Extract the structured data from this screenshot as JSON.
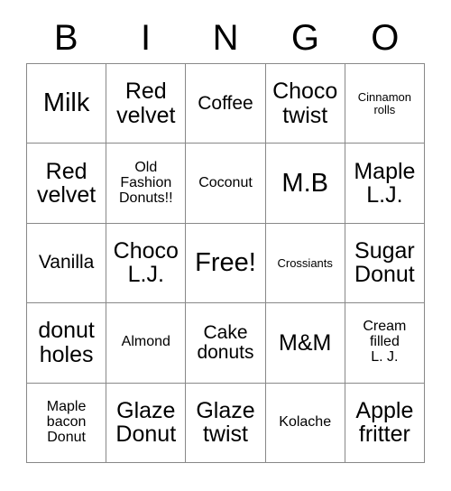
{
  "card": {
    "title": "BINGO",
    "header_letters": [
      "B",
      "I",
      "N",
      "G",
      "O"
    ],
    "grid_size": "5x5",
    "free_space_label": "Free!",
    "colors": {
      "background": "#ffffff",
      "text": "#000000",
      "grid_line": "#888888"
    },
    "rows": [
      [
        {
          "label": "Milk",
          "size": "xl"
        },
        {
          "label": "Red\nvelvet",
          "size": "lg"
        },
        {
          "label": "Coffee",
          "size": "md"
        },
        {
          "label": "Choco\ntwist",
          "size": "lg"
        },
        {
          "label": "Cinnamon\nrolls",
          "size": "xs"
        }
      ],
      [
        {
          "label": "Red\nvelvet",
          "size": "lg"
        },
        {
          "label": "Old\nFashion\nDonuts!!",
          "size": "sm"
        },
        {
          "label": "Coconut",
          "size": "sm"
        },
        {
          "label": "M.B",
          "size": "xl"
        },
        {
          "label": "Maple\nL.J.",
          "size": "lg"
        }
      ],
      [
        {
          "label": "Vanilla",
          "size": "md"
        },
        {
          "label": "Choco\nL.J.",
          "size": "lg"
        },
        {
          "label": "Free!",
          "size": "xl"
        },
        {
          "label": "Crossiants",
          "size": "xs"
        },
        {
          "label": "Sugar\nDonut",
          "size": "lg"
        }
      ],
      [
        {
          "label": "donut\nholes",
          "size": "lg"
        },
        {
          "label": "Almond",
          "size": "sm"
        },
        {
          "label": "Cake\ndonuts",
          "size": "md"
        },
        {
          "label": "M&M",
          "size": "lg"
        },
        {
          "label": "Cream\nfilled\nL. J.",
          "size": "sm"
        }
      ],
      [
        {
          "label": "Maple\nbacon\nDonut",
          "size": "sm"
        },
        {
          "label": "Glaze\nDonut",
          "size": "lg"
        },
        {
          "label": "Glaze\ntwist",
          "size": "lg"
        },
        {
          "label": "Kolache",
          "size": "sm"
        },
        {
          "label": "Apple\nfritter",
          "size": "lg"
        }
      ]
    ]
  }
}
